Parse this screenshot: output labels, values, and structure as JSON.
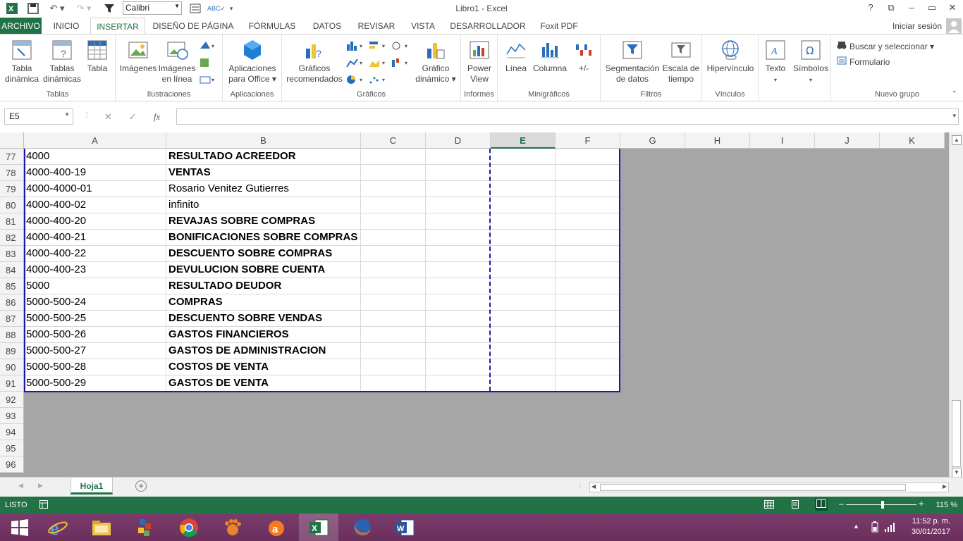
{
  "window": {
    "title": "Libro1 - Excel"
  },
  "quick_access": {
    "font_name": "Calibri"
  },
  "window_controls": {
    "help": "?",
    "restore_ribbon": "⧉",
    "minimize": "–",
    "maximize": "▭",
    "close": "✕"
  },
  "ribbon_tabs": [
    {
      "label": "ARCHIVO"
    },
    {
      "label": "INICIO"
    },
    {
      "label": "INSERTAR"
    },
    {
      "label": "DISEÑO DE PÁGINA"
    },
    {
      "label": "FÓRMULAS"
    },
    {
      "label": "DATOS"
    },
    {
      "label": "REVISAR"
    },
    {
      "label": "VISTA"
    },
    {
      "label": "DESARROLLADOR"
    },
    {
      "label": "Foxit PDF"
    }
  ],
  "signin": "Iniciar sesión",
  "ribbon": {
    "groups": {
      "tablas": "Tablas",
      "ilustraciones": "Ilustraciones",
      "aplicaciones": "Aplicaciones",
      "graficos": "Gráficos",
      "informes": "Informes",
      "minigraficos": "Minigráficos",
      "filtros": "Filtros",
      "vinculos": "Vínculos",
      "nuevo_grupo": "Nuevo grupo"
    },
    "buttons": {
      "tabla_dinamica_1": "Tabla",
      "tabla_dinamica_2": "dinámica",
      "tablas_dinamicas_1": "Tablas",
      "tablas_dinamicas_2": "dinámicas",
      "tabla": "Tabla",
      "imagenes": "Imágenes",
      "imagenes_linea_1": "Imágenes",
      "imagenes_linea_2": "en línea",
      "aplicaciones_1": "Aplicaciones",
      "aplicaciones_2": "para Office ▾",
      "graficos_rec_1": "Gráficos",
      "graficos_rec_2": "recomendados",
      "grafico_din_1": "Gráfico",
      "grafico_din_2": "dinámico ▾",
      "power_view_1": "Power",
      "power_view_2": "View",
      "linea": "Línea",
      "columna": "Columna",
      "ganancia": "+/-",
      "segmentacion_1": "Segmentación",
      "segmentacion_2": "de datos",
      "escala_1": "Escala de",
      "escala_2": "tiempo",
      "hipervinculo": "Hipervínculo",
      "texto": "Texto",
      "simbolos": "Símbolos",
      "buscar": "Buscar y seleccionar ▾",
      "formulario": "Formulario"
    }
  },
  "formula_bar": {
    "name_box": "E5",
    "fx": "fx",
    "formula": ""
  },
  "columns": [
    "A",
    "B",
    "C",
    "D",
    "E",
    "F",
    "G",
    "H",
    "I",
    "J",
    "K"
  ],
  "selected_column": "E",
  "rows": [
    {
      "n": "77",
      "a": "4000",
      "b": "RESULTADO ACREEDOR",
      "bold": true
    },
    {
      "n": "78",
      "a": "4000-400-19",
      "b": "VENTAS",
      "bold": true
    },
    {
      "n": "79",
      "a": "4000-4000-01",
      "b": "Rosario Venitez Gutierres",
      "bold": false
    },
    {
      "n": "80",
      "a": "4000-400-02",
      "b": "infinito",
      "bold": false
    },
    {
      "n": "81",
      "a": "4000-400-20",
      "b": "REVAJAS SOBRE COMPRAS",
      "bold": true
    },
    {
      "n": "82",
      "a": "4000-400-21",
      "b": "BONIFICACIONES SOBRE COMPRAS",
      "bold": true
    },
    {
      "n": "83",
      "a": "4000-400-22",
      "b": "DESCUENTO SOBRE COMPRAS",
      "bold": true
    },
    {
      "n": "84",
      "a": "4000-400-23",
      "b": "DEVULUCION SOBRE CUENTA",
      "bold": true
    },
    {
      "n": "85",
      "a": "5000",
      "b": "RESULTADO DEUDOR",
      "bold": true
    },
    {
      "n": "86",
      "a": "5000-500-24",
      "b": "COMPRAS",
      "bold": true
    },
    {
      "n": "87",
      "a": "5000-500-25",
      "b": "DESCUENTO SOBRE VENDAS",
      "bold": true
    },
    {
      "n": "88",
      "a": "5000-500-26",
      "b": "GASTOS FINANCIEROS",
      "bold": true
    },
    {
      "n": "89",
      "a": "5000-500-27",
      "b": "GASTOS DE ADMINISTRACION",
      "bold": true
    },
    {
      "n": "90",
      "a": "5000-500-28",
      "b": "COSTOS DE VENTA",
      "bold": true
    },
    {
      "n": "91",
      "a": "5000-500-29",
      "b": "GASTOS DE VENTA",
      "bold": true
    }
  ],
  "empty_rows": [
    "92",
    "93",
    "94",
    "95",
    "96"
  ],
  "sheets": [
    {
      "label": "Hoja1"
    }
  ],
  "status": {
    "mode": "LISTO",
    "zoom": "115 %"
  },
  "clock": {
    "time": "11:52 p. m.",
    "date": "30/01/2017"
  },
  "colors": {
    "excel_green": "#217346",
    "print_border": "#1a1aa6",
    "grid_bg": "#a6a6a6",
    "taskbar": "#6b2f5d"
  }
}
